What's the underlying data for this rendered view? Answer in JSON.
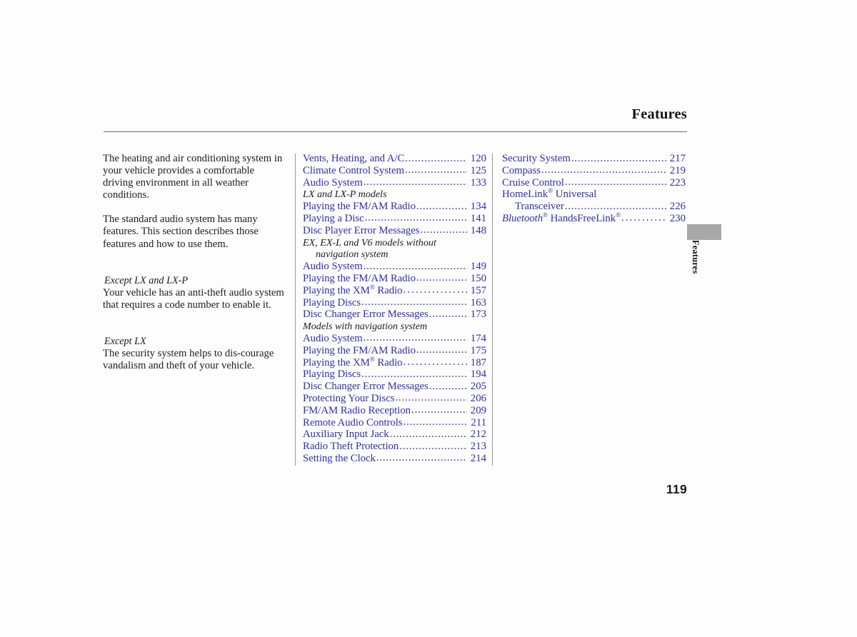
{
  "header": {
    "title": "Features"
  },
  "side_tab": {
    "label": "Features",
    "color": "#a8a8a8"
  },
  "folio": {
    "page_number": "119"
  },
  "colors": {
    "toc_link": "#2f2fa6",
    "body_text": "#1c1c1c",
    "rule": "#6d6d6d",
    "column_rule": "#9a9a9a",
    "background": "#fdfdfd"
  },
  "intro": {
    "paragraphs": [
      "The heating and air conditioning system in your vehicle provides a comfortable driving environment in all weather conditions.",
      "The standard audio system has many features. This section describes those features and how to use them."
    ],
    "sections": [
      {
        "heading": "Except LX and LX-P",
        "body": "Your vehicle has an anti-theft audio system that requires a code number to enable it."
      },
      {
        "heading": "Except LX",
        "body": "The security system helps to dis-courage vandalism and theft of your vehicle."
      }
    ]
  },
  "toc": {
    "middle_column": [
      {
        "type": "entry",
        "label": "Vents, Heating, and A/C",
        "page": "120"
      },
      {
        "type": "entry",
        "label": "Climate Control System",
        "page": "125"
      },
      {
        "type": "entry",
        "label": "Audio System",
        "page": "133"
      },
      {
        "type": "subheading",
        "label": "LX and LX-P models"
      },
      {
        "type": "entry",
        "label": "Playing the FM/AM Radio",
        "page": "134"
      },
      {
        "type": "entry",
        "label": "Playing a Disc",
        "page": "141"
      },
      {
        "type": "entry",
        "label": "Disc Player Error Messages",
        "page": "148"
      },
      {
        "type": "subheading",
        "label": "EX, EX-L and V6 models without"
      },
      {
        "type": "subheading-cont",
        "label": "navigation system"
      },
      {
        "type": "entry",
        "label": "Audio System",
        "page": "149"
      },
      {
        "type": "entry",
        "label": "Playing the FM/AM Radio",
        "page": "150"
      },
      {
        "type": "entry-reg",
        "label": "Playing the XM",
        "suffix": " Radio",
        "page": "157"
      },
      {
        "type": "entry",
        "label": "Playing Discs",
        "page": "163"
      },
      {
        "type": "entry",
        "label": "Disc Changer Error Messages",
        "page": "173"
      },
      {
        "type": "subheading",
        "label": "Models with navigation system"
      },
      {
        "type": "entry",
        "label": "Audio System",
        "page": "174"
      },
      {
        "type": "entry",
        "label": "Playing the FM/AM Radio",
        "page": "175"
      },
      {
        "type": "entry-reg",
        "label": "Playing the XM",
        "suffix": " Radio",
        "page": "187"
      },
      {
        "type": "entry",
        "label": "Playing Discs",
        "page": "194"
      },
      {
        "type": "entry",
        "label": "Disc Changer Error Messages",
        "page": "205"
      },
      {
        "type": "entry",
        "label": "Protecting Your Discs",
        "page": "206"
      },
      {
        "type": "entry",
        "label": "FM/AM Radio Reception",
        "page": "209"
      },
      {
        "type": "entry",
        "label": "Remote Audio Controls",
        "page": "211"
      },
      {
        "type": "entry",
        "label": "Auxiliary Input Jack",
        "page": "212"
      },
      {
        "type": "entry",
        "label": "Radio Theft Protection",
        "page": "213"
      },
      {
        "type": "entry",
        "label": "Setting the Clock",
        "page": "214"
      }
    ],
    "right_column": [
      {
        "type": "entry",
        "label": "Security System",
        "page": "217"
      },
      {
        "type": "entry",
        "label": "Compass",
        "page": "219"
      },
      {
        "type": "entry",
        "label": "Cruise Control",
        "page": "223"
      },
      {
        "type": "plain-reg",
        "label": "HomeLink",
        "suffix": " Universal"
      },
      {
        "type": "entry-indent",
        "label": "Transceiver",
        "page": "226"
      },
      {
        "type": "entry-bluetooth",
        "label": "Bluetooth",
        "suffix": " HandsFreeLink",
        "page": "230"
      }
    ]
  }
}
